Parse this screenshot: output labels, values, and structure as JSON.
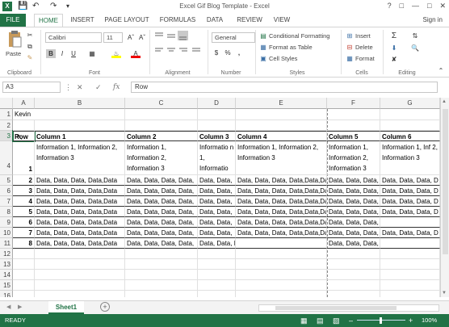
{
  "app": {
    "title": "Excel Gif Blog Template - Excel",
    "logo": "X",
    "signin": "Sign in"
  },
  "tabs": [
    "FILE",
    "HOME",
    "INSERT",
    "PAGE LAYOUT",
    "FORMULAS",
    "DATA",
    "REVIEW",
    "VIEW"
  ],
  "ribbon": {
    "clipboard": {
      "paste": "Paste",
      "label": "Clipboard"
    },
    "font": {
      "name": "Calibri",
      "size": "11",
      "bold": "B",
      "italic": "I",
      "underline": "U",
      "label": "Font"
    },
    "alignment": {
      "label": "Alignment"
    },
    "number": {
      "format": "General",
      "pct": "%",
      "comma": ",",
      "label": "Number"
    },
    "styles": {
      "conditional": "Conditional Formatting",
      "format_table": "Format as Table",
      "cell_styles": "Cell Styles",
      "label": "Styles"
    },
    "cells": {
      "insert": "Insert",
      "delete": "Delete",
      "format": "Format",
      "label": "Cells"
    },
    "editing": {
      "label": "Editing"
    }
  },
  "formula": {
    "namebox": "A3",
    "fx": "fx",
    "value": "Row"
  },
  "grid": {
    "columns": [
      "A",
      "B",
      "C",
      "D",
      "E",
      "F",
      "G"
    ],
    "rows": [
      "1",
      "2",
      "3",
      "4",
      "5",
      "6",
      "7",
      "8",
      "9",
      "10",
      "11",
      "12",
      "13",
      "14",
      "15",
      "16"
    ],
    "a1": "Kevin",
    "header_row": [
      "Row",
      "Column 1",
      "Column 2",
      "Column 3",
      "Column 4",
      "Column 5",
      "Column 6"
    ],
    "info_row": [
      "1",
      "Information 1, Information 2, Information 3",
      "Information 1, Information 2, Information 3",
      "Informatio n 1, Informatio",
      "Information 1, Information 2, Information 3",
      "Information 1, Information 2, Information 3",
      "Information 1, Inf 2, Information 3"
    ],
    "data_rows": [
      [
        "2",
        "Data, Data, Data, Data,Data",
        "Data, Data, Data, Data,",
        "Data, Data,",
        "Data, Data, Data, Data,Data,Data",
        "Data, Data, Data,",
        "Data, Data, Data, D"
      ],
      [
        "3",
        "Data, Data, Data, Data,Data",
        "Data, Data, Data, Data,",
        "Data, Data,",
        "Data, Data, Data, Data,Data,Data",
        "Data, Data, Data,",
        "Data, Data, Data, D"
      ],
      [
        "4",
        "Data, Data, Data, Data,Data",
        "Data, Data, Data, Data,",
        "Data, Data,",
        "Data, Data, Data, Data,Data,Data",
        "Data, Data, Data,",
        "Data, Data, Data, D"
      ],
      [
        "5",
        "Data, Data, Data, Data,Data",
        "Data, Data, Data, Data,",
        "Data, Data,",
        "Data, Data, Data, Data,Data,Data",
        "Data, Data, Data,",
        "Data, Data, Data, D"
      ],
      [
        "6",
        "Data, Data, Data, Data,Data",
        "Data, Data, Data, Data,",
        "Data, Data,",
        "Data, Data, Data, Data,Data,Data",
        "Data, Data, Data, Data,Data",
        ""
      ],
      [
        "7",
        "Data, Data, Data, Data,Data",
        "Data, Data, Data, Data,",
        "Data, Data,",
        "Data, Data, Data, Data,Data,Data",
        "Data, Data, Data,",
        "Data, Data, Data, D"
      ],
      [
        "8",
        "Data, Data, Data, Data,Data",
        "Data, Data, Data, Data,",
        "Data, Data, Data, Data,Data",
        "",
        "Data, Data, Data, Data,Data",
        ""
      ]
    ]
  },
  "sheet": {
    "name": "Sheet1",
    "add": "+"
  },
  "status": {
    "ready": "READY",
    "zoom": "100%"
  }
}
